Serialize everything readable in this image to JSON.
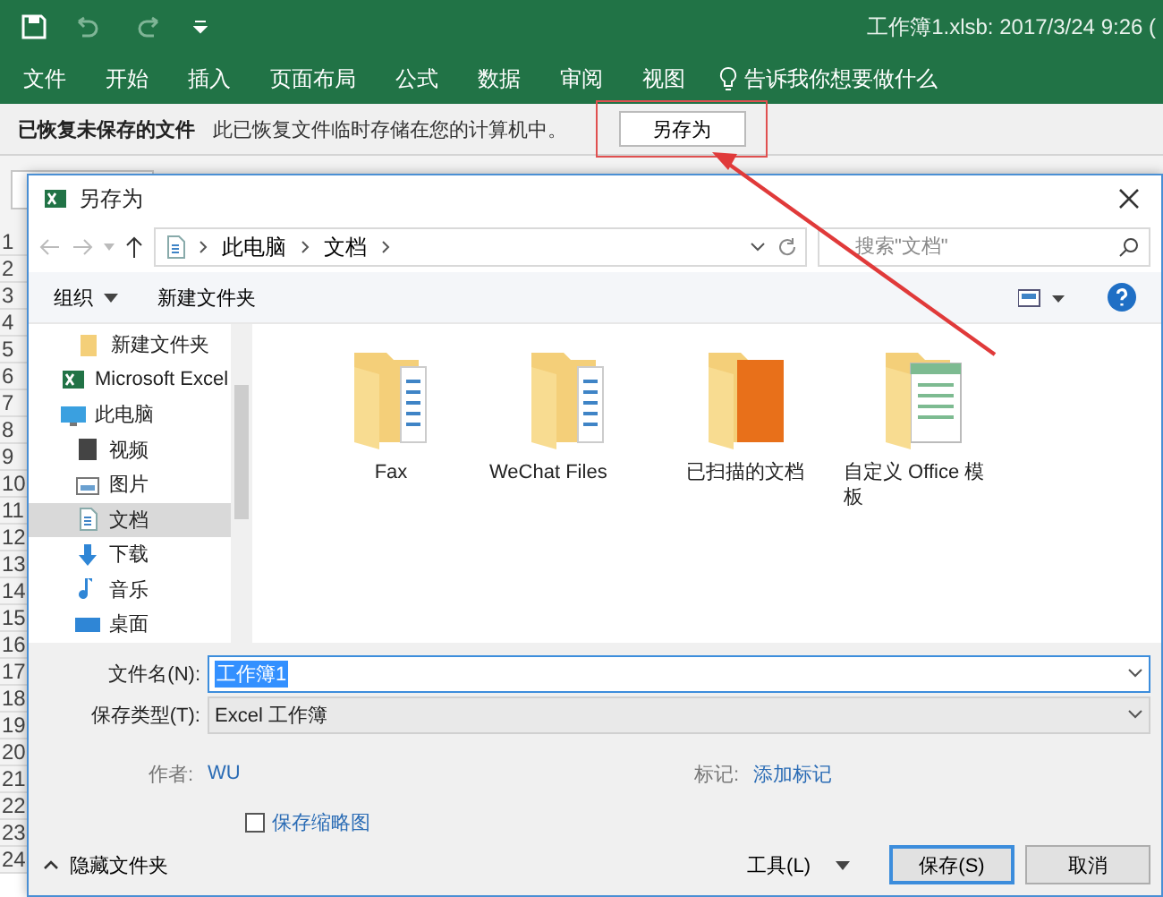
{
  "excel": {
    "title": "工作簿1.xlsb: 2017/3/24 9:26 (",
    "ribbon_tabs": [
      "文件",
      "开始",
      "插入",
      "页面布局",
      "公式",
      "数据",
      "审阅",
      "视图"
    ],
    "tell_me": "告诉我你想要做什么",
    "recovery_bar": {
      "title": "已恢复未保存的文件",
      "message": "此已恢复文件临时存储在您的计算机中。",
      "button": "另存为"
    },
    "row_numbers": [
      "1",
      "2",
      "3",
      "4",
      "5",
      "6",
      "7",
      "8",
      "9",
      "10",
      "11",
      "12",
      "13",
      "14",
      "15",
      "16",
      "17",
      "18",
      "19",
      "20",
      "21",
      "22",
      "23",
      "24"
    ]
  },
  "dialog": {
    "title": "另存为",
    "breadcrumb": [
      "此电脑",
      "文档"
    ],
    "search": {
      "placeholder": "搜索\"文档\""
    },
    "toolbar": {
      "organize": "组织",
      "new_folder": "新建文件夹"
    },
    "nav_items": [
      {
        "label": "新建文件夹",
        "kind": "folder",
        "selected": false
      },
      {
        "label": "Microsoft Excel",
        "kind": "excel",
        "selected": false
      },
      {
        "label": "此电脑",
        "kind": "computer",
        "selected": false,
        "children": [
          {
            "label": "视频",
            "kind": "video",
            "selected": false
          },
          {
            "label": "图片",
            "kind": "pictures",
            "selected": false
          },
          {
            "label": "文档",
            "kind": "documents",
            "selected": true
          },
          {
            "label": "下载",
            "kind": "download",
            "selected": false
          },
          {
            "label": "音乐",
            "kind": "music",
            "selected": false
          },
          {
            "label": "桌面",
            "kind": "desktop",
            "selected": false
          }
        ]
      }
    ],
    "files": [
      {
        "name": "Fax",
        "kind": "docs"
      },
      {
        "name": "WeChat Files",
        "kind": "docs"
      },
      {
        "name": "已扫描的文档",
        "kind": "photo"
      },
      {
        "name": "自定义 Office 模板",
        "kind": "sheet"
      }
    ],
    "file_name": {
      "label": "文件名(N):",
      "value": "工作簿1",
      "value_selected": true
    },
    "save_type": {
      "label": "保存类型(T):",
      "value": "Excel 工作簿"
    },
    "author": {
      "label": "作者:",
      "value": "WU"
    },
    "tags": {
      "label": "标记:",
      "value": "添加标记"
    },
    "thumbnail": {
      "label": "保存缩略图",
      "checked": false
    },
    "hide_folders": "隐藏文件夹",
    "tools": "工具(L)",
    "buttons": [
      {
        "label": "保存(S)",
        "kind": "primary"
      },
      {
        "label": "取消",
        "kind": "normal"
      }
    ]
  }
}
